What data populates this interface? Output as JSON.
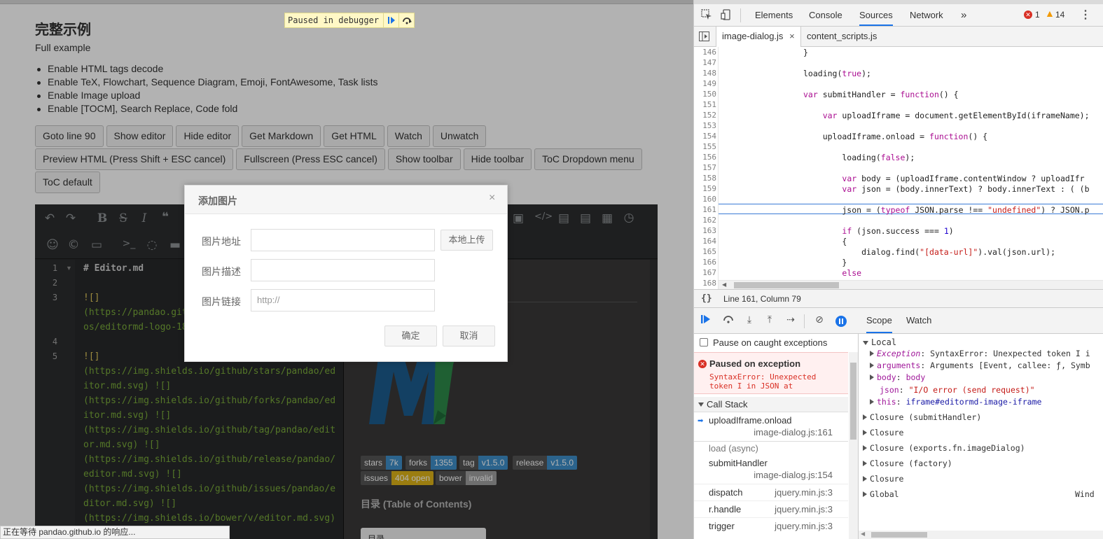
{
  "page": {
    "title": "完整示例",
    "subtitle": "Full example",
    "features": [
      "Enable HTML tags decode",
      "Enable TeX, Flowchart, Sequence Diagram, Emoji, FontAwesome, Task lists",
      "Enable Image upload",
      "Enable [TOCM], Search Replace, Code fold"
    ],
    "buttons_row1": [
      "Goto line 90",
      "Show editor",
      "Hide editor",
      "Get Markdown",
      "Get HTML",
      "Watch",
      "Unwatch"
    ],
    "buttons_row2": [
      "Preview HTML (Press Shift + ESC cancel)",
      "Fullscreen (Press ESC cancel)",
      "Show toolbar",
      "Hide toolbar",
      "ToC Dropdown menu"
    ],
    "buttons_row3": [
      "ToC default"
    ],
    "paused_label": "Paused in debugger",
    "status_bar": "正在等待 pandao.github.io 的响应..."
  },
  "editor": {
    "line_numbers": [
      "1",
      "2",
      "3",
      "4",
      "5"
    ],
    "code_lines": [
      {
        "text": "# Editor.md",
        "cls": "c-h"
      },
      {
        "text": "![]",
        "cls": "c-b"
      },
      {
        "text": "(https://pandao.git",
        "cls": "c-u"
      },
      {
        "text": "os/editormd-logo-18",
        "cls": "c-u"
      },
      {
        "text": "![]",
        "cls": "c-b"
      },
      {
        "text": "(https://img.shields.io/github/stars/pandao/ed",
        "cls": "c-u"
      },
      {
        "text": "itor.md.svg) ![]",
        "cls": "c-u"
      },
      {
        "text": "(https://img.shields.io/github/forks/pandao/ed",
        "cls": "c-u"
      },
      {
        "text": "itor.md.svg) ![]",
        "cls": "c-u"
      },
      {
        "text": "(https://img.shields.io/github/tag/pandao/edit",
        "cls": "c-u"
      },
      {
        "text": "or.md.svg) ![]",
        "cls": "c-u"
      },
      {
        "text": "(https://img.shields.io/github/release/pandao/",
        "cls": "c-u"
      },
      {
        "text": "editor.md.svg) ![]",
        "cls": "c-u"
      },
      {
        "text": "(https://img.shields.io/github/issues/pandao/e",
        "cls": "c-u"
      },
      {
        "text": "ditor.md.svg) ![]",
        "cls": "c-u"
      },
      {
        "text": "(https://img.shields.io/bower/v/editor.md.svg)",
        "cls": "c-u"
      }
    ],
    "badges": [
      {
        "key": "stars",
        "val": "7k",
        "color": "#3e8fc9"
      },
      {
        "key": "forks",
        "val": "1355",
        "color": "#3e8fc9"
      },
      {
        "key": "tag",
        "val": "v1.5.0",
        "color": "#3e8fc9"
      },
      {
        "key": "release",
        "val": "v1.5.0",
        "color": "#3e8fc9"
      },
      {
        "key": "issues",
        "val": "404 open",
        "color": "#dfb317"
      },
      {
        "key": "bower",
        "val": "invalid",
        "color": "#9f9f9f"
      }
    ],
    "toc_heading": "目录 (Table of Contents)",
    "toc_dropdown": "目录"
  },
  "dialog": {
    "title": "添加图片",
    "close": "×",
    "label_url": "图片地址",
    "label_desc": "图片描述",
    "label_link": "图片链接",
    "upload_button": "本地上传",
    "link_placeholder": "http://",
    "ok": "确定",
    "cancel": "取消"
  },
  "devtools": {
    "tabs": [
      "Elements",
      "Console",
      "Sources",
      "Network"
    ],
    "more": "»",
    "errors": "1",
    "warnings": "14",
    "files": [
      "image-dialog.js",
      "content_scripts.js"
    ],
    "file_close": "×",
    "status": "Line 161, Column 79",
    "pause_on_caught": "Pause on caught exceptions",
    "paused_on_exception": "Paused on exception",
    "exception_msg": "SyntaxError: Unexpected token I in JSON at",
    "call_stack_label": "Call Stack",
    "call_stack": [
      {
        "fn": "uploadIframe.onload",
        "loc": "image-dialog.js:161"
      },
      {
        "fn": "load (async)",
        "loc": ""
      },
      {
        "fn": "submitHandler",
        "loc": "image-dialog.js:154"
      },
      {
        "fn": "dispatch",
        "loc": "jquery.min.js:3"
      },
      {
        "fn": "r.handle",
        "loc": "jquery.min.js:3"
      },
      {
        "fn": "trigger",
        "loc": "jquery.min.js:3"
      }
    ],
    "scope_tabs": [
      "Scope",
      "Watch"
    ],
    "scope_local": "Local",
    "scope_items": [
      {
        "key": "Exception",
        "val": "SyntaxError: Unexpected token I i"
      },
      {
        "key": "arguments",
        "val": "Arguments [Event, callee: ƒ, Symb"
      },
      {
        "key": "body",
        "val": "body"
      },
      {
        "key": "json",
        "val": "\"I/O error (send request)\""
      },
      {
        "key": "this",
        "val": "iframe#editormd-image-iframe"
      }
    ],
    "closures": [
      "Closure (submitHandler)",
      "Closure",
      "Closure (exports.fn.imageDialog)",
      "Closure (factory)",
      "Closure",
      "Global"
    ],
    "global_value": "Wind",
    "line_numbers": [
      "146",
      "147",
      "148",
      "149",
      "150",
      "151",
      "152",
      "153",
      "154",
      "155",
      "156",
      "157",
      "158",
      "159",
      "160",
      "161",
      "162",
      "163",
      "164",
      "165",
      "166",
      "167",
      "168"
    ],
    "code": [
      "}",
      "",
      "loading(true);",
      "",
      "var submitHandler = function() {",
      "",
      "    var uploadIframe = document.getElementById(iframeName);",
      "",
      "    uploadIframe.onload = function() {",
      "",
      "        loading(false);",
      "",
      "        var body = (uploadIframe.contentWindow ? uploadIfr",
      "        var json = (body.innerText) ? body.innerText : ( (b",
      "",
      "        json = (typeof JSON.parse !== \"undefined\") ? JSON.p",
      "",
      "        if (json.success === 1)",
      "        {",
      "            dialog.find(\"[data-url]\").val(json.url);",
      "        }",
      "        else",
      ""
    ]
  }
}
